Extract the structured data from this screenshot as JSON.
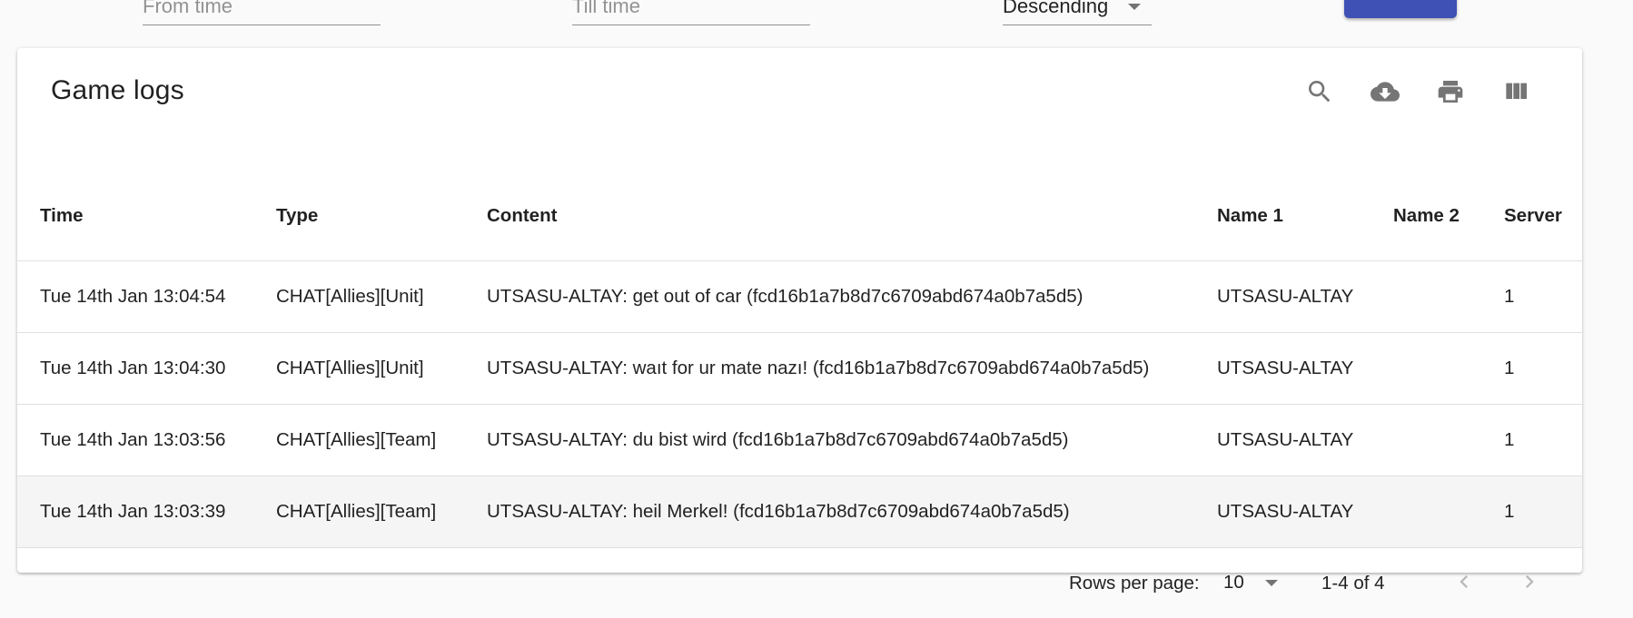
{
  "filters": {
    "from_placeholder": "From time",
    "till_placeholder": "Till time",
    "sort_value": "Descending"
  },
  "card": {
    "title": "Game logs",
    "toolbar_icons": [
      "search-icon",
      "cloud-download-icon",
      "print-icon",
      "view-column-icon"
    ]
  },
  "table": {
    "headers": {
      "time": "Time",
      "type": "Type",
      "content": "Content",
      "name1": "Name 1",
      "name2": "Name 2",
      "server": "Server"
    },
    "rows": [
      {
        "time": "Tue 14th Jan 13:04:54",
        "type": "CHAT[Allies][Unit]",
        "content": "UTSASU-ALTAY: get out of car (fcd16b1a7b8d7c6709abd674a0b7a5d5)",
        "name1": "UTSASU-ALTAY",
        "name2": "",
        "server": "1"
      },
      {
        "time": "Tue 14th Jan 13:04:30",
        "type": "CHAT[Allies][Unit]",
        "content": "UTSASU-ALTAY: waıt for ur mate nazı! (fcd16b1a7b8d7c6709abd674a0b7a5d5)",
        "name1": "UTSASU-ALTAY",
        "name2": "",
        "server": "1"
      },
      {
        "time": "Tue 14th Jan 13:03:56",
        "type": "CHAT[Allies][Team]",
        "content": "UTSASU-ALTAY: du bist wird (fcd16b1a7b8d7c6709abd674a0b7a5d5)",
        "name1": "UTSASU-ALTAY",
        "name2": "",
        "server": "1"
      },
      {
        "time": "Tue 14th Jan 13:03:39",
        "type": "CHAT[Allies][Team]",
        "content": "UTSASU-ALTAY: heil Merkel! (fcd16b1a7b8d7c6709abd674a0b7a5d5)",
        "name1": "UTSASU-ALTAY",
        "name2": "",
        "server": "1"
      }
    ]
  },
  "pagination": {
    "rows_per_page_label": "Rows per page:",
    "rows_per_page_value": "10",
    "range": "1-4 of 4"
  },
  "colors": {
    "primary": "#3f51b5",
    "row_hover": "#f5f5f5"
  }
}
